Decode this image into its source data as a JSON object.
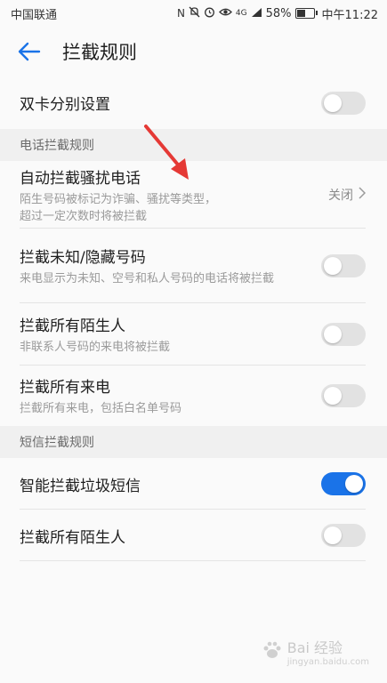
{
  "status_bar": {
    "carrier": "中国联通",
    "network": "4G",
    "battery": "58%",
    "battery_fraction": 0.58,
    "time": "中午11:22"
  },
  "header": {
    "title": "拦截规则"
  },
  "rows": {
    "dual_sim": {
      "title": "双卡分别设置",
      "toggle_on": false
    },
    "section_call": "电话拦截规则",
    "auto_block": {
      "title": "自动拦截骚扰电话",
      "subtitle": "陌生号码被标记为诈骗、骚扰等类型，超过一定次数时将被拦截",
      "value": "关闭"
    },
    "unknown_hidden": {
      "title": "拦截未知/隐藏号码",
      "subtitle": "来电显示为未知、空号和私人号码的电话将被拦截",
      "toggle_on": false
    },
    "all_strangers_call": {
      "title": "拦截所有陌生人",
      "subtitle": "非联系人号码的来电将被拦截",
      "toggle_on": false
    },
    "all_calls": {
      "title": "拦截所有来电",
      "subtitle": "拦截所有来电，包括白名单号码",
      "toggle_on": false
    },
    "section_sms": "短信拦截规则",
    "smart_sms": {
      "title": "智能拦截垃圾短信",
      "toggle_on": true
    },
    "all_strangers_sms": {
      "title": "拦截所有陌生人",
      "toggle_on": false
    }
  },
  "watermark": {
    "text": "Bai 经验",
    "sub": "jingyan.baidu.com"
  },
  "colors": {
    "accent": "#1a73e8",
    "arrow": "#e53935"
  }
}
